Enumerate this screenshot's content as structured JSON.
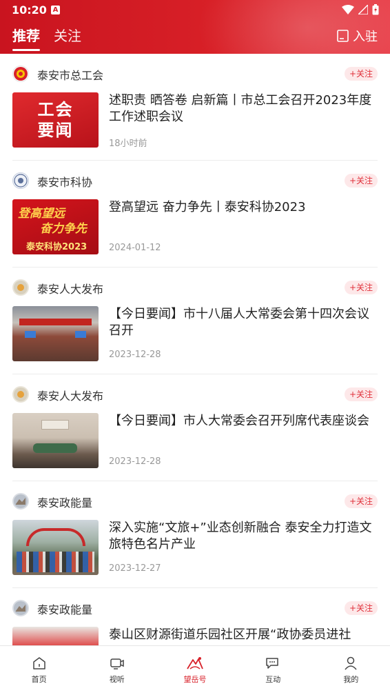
{
  "status": {
    "time": "10:20"
  },
  "tabs": [
    {
      "label": "推荐"
    },
    {
      "label": "关注"
    }
  ],
  "header": {
    "join_label": "入驻"
  },
  "feed": [
    {
      "source": "泰安市总工会",
      "follow": "+关注",
      "title": "述职责 晒答卷 启新篇丨市总工会召开2023年度工作述职会议",
      "meta": "18小时前",
      "thumb_text": [
        "工会",
        "要闻"
      ]
    },
    {
      "source": "泰安市科协",
      "follow": "+关注",
      "title": "登高望远 奋力争先丨泰安科协2023",
      "meta": "2024-01-12",
      "thumb_text": [
        "登高望远",
        "奋力争先",
        "泰安科协2023"
      ]
    },
    {
      "source": "泰安人大发布",
      "follow": "+关注",
      "title": "【今日要闻】市十八届人大常委会第十四次会议召开",
      "meta": "2023-12-28"
    },
    {
      "source": "泰安人大发布",
      "follow": "+关注",
      "title": "【今日要闻】市人大常委会召开列席代表座谈会",
      "meta": "2023-12-28"
    },
    {
      "source": "泰安政能量",
      "follow": "+关注",
      "title": "深入实施“文旅+”业态创新融合 泰安全力打造文旅特色名片产业",
      "meta": "2023-12-27"
    },
    {
      "source": "泰安政能量",
      "follow": "+关注",
      "title": "泰山区财源街道乐园社区开展“政协委员进社",
      "meta": ""
    }
  ],
  "nav": [
    {
      "label": "首页"
    },
    {
      "label": "视听"
    },
    {
      "label": "望岳号"
    },
    {
      "label": "互动"
    },
    {
      "label": "我的"
    }
  ],
  "colors": {
    "brand": "#d8212a",
    "follow_bg": "#fde8e9"
  }
}
